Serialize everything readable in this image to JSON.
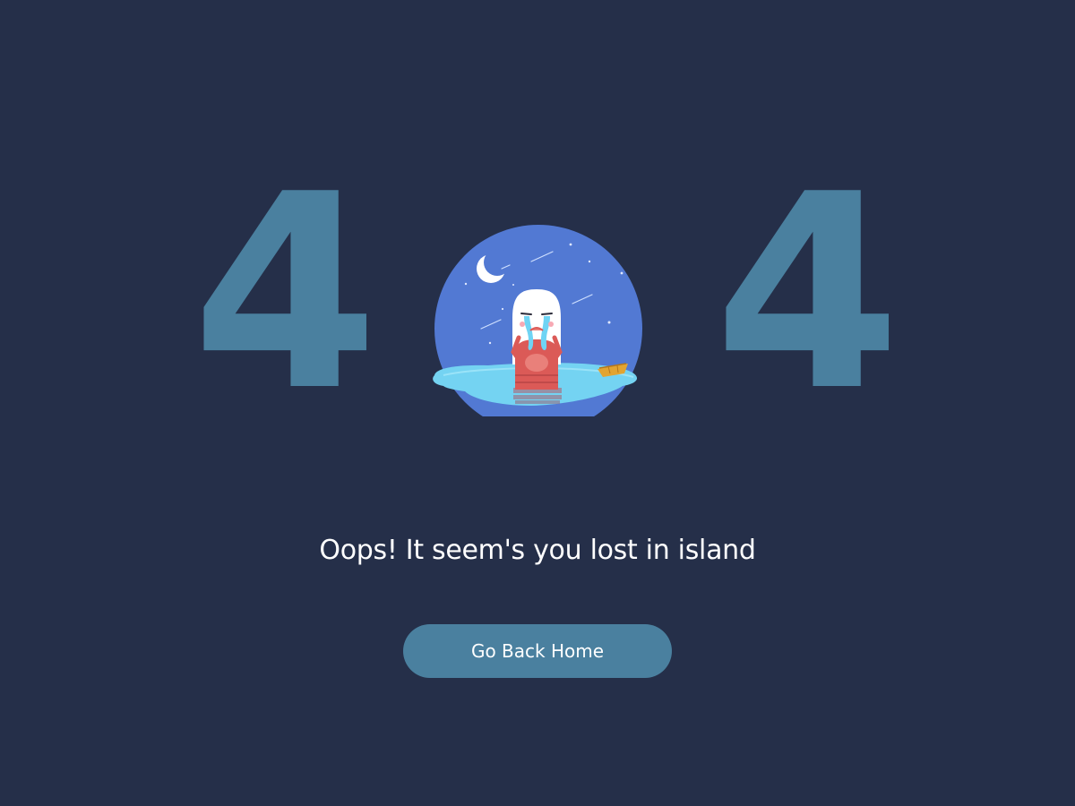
{
  "error_code": {
    "first_digit": "4",
    "last_digit": "4"
  },
  "illustration": {
    "icon": "crying-girl-on-island-icon",
    "colors": {
      "sky": "#5279d3",
      "water": "#74d3f2",
      "dress": "#db5a57",
      "boat": "#e2a431"
    }
  },
  "message": {
    "text": "Oops! It seem's you lost in island"
  },
  "home_button": {
    "label": "Go Back Home"
  },
  "colors": {
    "background": "#252f49",
    "accent": "#4a809f",
    "text": "#ffffff"
  }
}
